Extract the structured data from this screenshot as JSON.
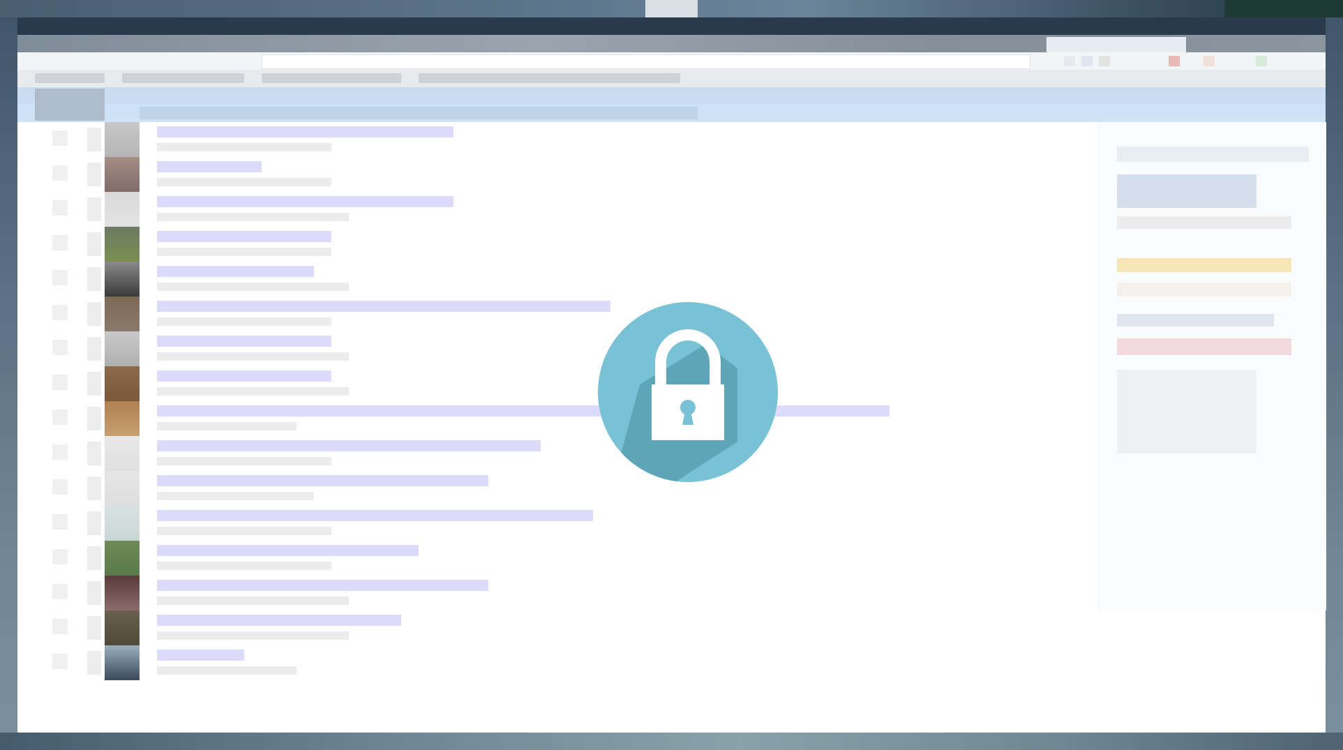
{
  "window": {
    "accent_color": "#cee3f8",
    "background_color": "#ffffff"
  },
  "overlay": {
    "icon": "lock-icon",
    "circle_color": "#79c2d6",
    "shadow_color": "#5fa5b8",
    "glyph_color": "#ffffff"
  },
  "posts": [
    {
      "thumb_colors": [
        "#c8c8c8",
        "#b5b5b5"
      ]
    },
    {
      "thumb_colors": [
        "#a58e86",
        "#7f6b68"
      ]
    },
    {
      "thumb_colors": [
        "#dadada",
        "#e3e3e3"
      ]
    },
    {
      "thumb_colors": [
        "#6a7a62",
        "#7a8f52"
      ]
    },
    {
      "thumb_colors": [
        "#8a8a8a",
        "#3a3a3a"
      ]
    },
    {
      "thumb_colors": [
        "#7d6a55",
        "#8a7a6a"
      ]
    },
    {
      "thumb_colors": [
        "#c9c9c9",
        "#b0b0b0"
      ]
    },
    {
      "thumb_colors": [
        "#8a6a4a",
        "#7a5a3a"
      ]
    },
    {
      "thumb_colors": [
        "#b08050",
        "#c8a070"
      ]
    },
    {
      "thumb_colors": [
        "#e8e8e8",
        "#e0e0e0"
      ]
    },
    {
      "thumb_colors": [
        "#e6e6e6",
        "#dedede"
      ]
    },
    {
      "thumb_colors": [
        "#d9e2e2",
        "#c9d6d6"
      ]
    },
    {
      "thumb_colors": [
        "#6f8a56",
        "#5a7a4a"
      ]
    },
    {
      "thumb_colors": [
        "#5a3a3a",
        "#8a6a6a"
      ]
    },
    {
      "thumb_colors": [
        "#6a6050",
        "#504838"
      ]
    },
    {
      "thumb_colors": [
        "#9ab0c0",
        "#3a4a5a"
      ]
    }
  ]
}
